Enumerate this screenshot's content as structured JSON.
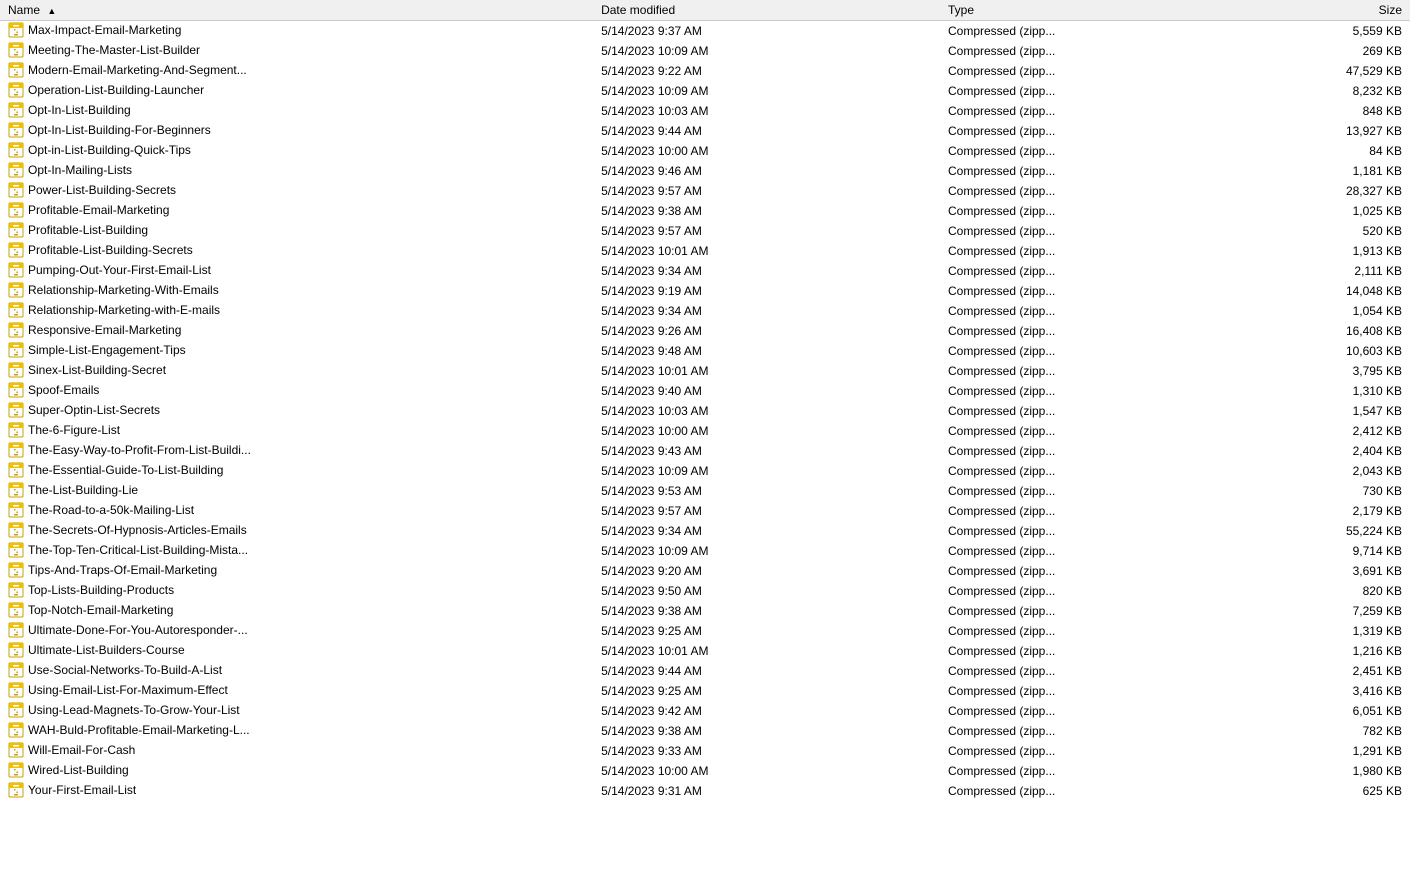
{
  "columns": [
    {
      "id": "name",
      "label": "Name",
      "sortable": true,
      "sort_arrow": "▲"
    },
    {
      "id": "date_modified",
      "label": "Date modified",
      "sortable": true
    },
    {
      "id": "type",
      "label": "Type",
      "sortable": true
    },
    {
      "id": "size",
      "label": "Size",
      "sortable": true
    }
  ],
  "files": [
    {
      "name": "Max-Impact-Email-Marketing",
      "date": "5/14/2023 9:37 AM",
      "type": "Compressed (zipp...",
      "size": "5,559 KB"
    },
    {
      "name": "Meeting-The-Master-List-Builder",
      "date": "5/14/2023 10:09 AM",
      "type": "Compressed (zipp...",
      "size": "269 KB"
    },
    {
      "name": "Modern-Email-Marketing-And-Segment...",
      "date": "5/14/2023 9:22 AM",
      "type": "Compressed (zipp...",
      "size": "47,529 KB"
    },
    {
      "name": "Operation-List-Building-Launcher",
      "date": "5/14/2023 10:09 AM",
      "type": "Compressed (zipp...",
      "size": "8,232 KB"
    },
    {
      "name": "Opt-In-List-Building",
      "date": "5/14/2023 10:03 AM",
      "type": "Compressed (zipp...",
      "size": "848 KB"
    },
    {
      "name": "Opt-In-List-Building-For-Beginners",
      "date": "5/14/2023 9:44 AM",
      "type": "Compressed (zipp...",
      "size": "13,927 KB"
    },
    {
      "name": "Opt-in-List-Building-Quick-Tips",
      "date": "5/14/2023 10:00 AM",
      "type": "Compressed (zipp...",
      "size": "84 KB"
    },
    {
      "name": "Opt-In-Mailing-Lists",
      "date": "5/14/2023 9:46 AM",
      "type": "Compressed (zipp...",
      "size": "1,181 KB"
    },
    {
      "name": "Power-List-Building-Secrets",
      "date": "5/14/2023 9:57 AM",
      "type": "Compressed (zipp...",
      "size": "28,327 KB"
    },
    {
      "name": "Profitable-Email-Marketing",
      "date": "5/14/2023 9:38 AM",
      "type": "Compressed (zipp...",
      "size": "1,025 KB"
    },
    {
      "name": "Profitable-List-Building",
      "date": "5/14/2023 9:57 AM",
      "type": "Compressed (zipp...",
      "size": "520 KB"
    },
    {
      "name": "Profitable-List-Building-Secrets",
      "date": "5/14/2023 10:01 AM",
      "type": "Compressed (zipp...",
      "size": "1,913 KB"
    },
    {
      "name": "Pumping-Out-Your-First-Email-List",
      "date": "5/14/2023 9:34 AM",
      "type": "Compressed (zipp...",
      "size": "2,111 KB"
    },
    {
      "name": "Relationship-Marketing-With-Emails",
      "date": "5/14/2023 9:19 AM",
      "type": "Compressed (zipp...",
      "size": "14,048 KB"
    },
    {
      "name": "Relationship-Marketing-with-E-mails",
      "date": "5/14/2023 9:34 AM",
      "type": "Compressed (zipp...",
      "size": "1,054 KB"
    },
    {
      "name": "Responsive-Email-Marketing",
      "date": "5/14/2023 9:26 AM",
      "type": "Compressed (zipp...",
      "size": "16,408 KB"
    },
    {
      "name": "Simple-List-Engagement-Tips",
      "date": "5/14/2023 9:48 AM",
      "type": "Compressed (zipp...",
      "size": "10,603 KB"
    },
    {
      "name": "Sinex-List-Building-Secret",
      "date": "5/14/2023 10:01 AM",
      "type": "Compressed (zipp...",
      "size": "3,795 KB"
    },
    {
      "name": "Spoof-Emails",
      "date": "5/14/2023 9:40 AM",
      "type": "Compressed (zipp...",
      "size": "1,310 KB"
    },
    {
      "name": "Super-Optin-List-Secrets",
      "date": "5/14/2023 10:03 AM",
      "type": "Compressed (zipp...",
      "size": "1,547 KB"
    },
    {
      "name": "The-6-Figure-List",
      "date": "5/14/2023 10:00 AM",
      "type": "Compressed (zipp...",
      "size": "2,412 KB"
    },
    {
      "name": "The-Easy-Way-to-Profit-From-List-Buildi...",
      "date": "5/14/2023 9:43 AM",
      "type": "Compressed (zipp...",
      "size": "2,404 KB"
    },
    {
      "name": "The-Essential-Guide-To-List-Building",
      "date": "5/14/2023 10:09 AM",
      "type": "Compressed (zipp...",
      "size": "2,043 KB"
    },
    {
      "name": "The-List-Building-Lie",
      "date": "5/14/2023 9:53 AM",
      "type": "Compressed (zipp...",
      "size": "730 KB"
    },
    {
      "name": "The-Road-to-a-50k-Mailing-List",
      "date": "5/14/2023 9:57 AM",
      "type": "Compressed (zipp...",
      "size": "2,179 KB"
    },
    {
      "name": "The-Secrets-Of-Hypnosis-Articles-Emails",
      "date": "5/14/2023 9:34 AM",
      "type": "Compressed (zipp...",
      "size": "55,224 KB"
    },
    {
      "name": "The-Top-Ten-Critical-List-Building-Mista...",
      "date": "5/14/2023 10:09 AM",
      "type": "Compressed (zipp...",
      "size": "9,714 KB"
    },
    {
      "name": "Tips-And-Traps-Of-Email-Marketing",
      "date": "5/14/2023 9:20 AM",
      "type": "Compressed (zipp...",
      "size": "3,691 KB"
    },
    {
      "name": "Top-Lists-Building-Products",
      "date": "5/14/2023 9:50 AM",
      "type": "Compressed (zipp...",
      "size": "820 KB"
    },
    {
      "name": "Top-Notch-Email-Marketing",
      "date": "5/14/2023 9:38 AM",
      "type": "Compressed (zipp...",
      "size": "7,259 KB"
    },
    {
      "name": "Ultimate-Done-For-You-Autoresponder-...",
      "date": "5/14/2023 9:25 AM",
      "type": "Compressed (zipp...",
      "size": "1,319 KB"
    },
    {
      "name": "Ultimate-List-Builders-Course",
      "date": "5/14/2023 10:01 AM",
      "type": "Compressed (zipp...",
      "size": "1,216 KB"
    },
    {
      "name": "Use-Social-Networks-To-Build-A-List",
      "date": "5/14/2023 9:44 AM",
      "type": "Compressed (zipp...",
      "size": "2,451 KB"
    },
    {
      "name": "Using-Email-List-For-Maximum-Effect",
      "date": "5/14/2023 9:25 AM",
      "type": "Compressed (zipp...",
      "size": "3,416 KB"
    },
    {
      "name": "Using-Lead-Magnets-To-Grow-Your-List",
      "date": "5/14/2023 9:42 AM",
      "type": "Compressed (zipp...",
      "size": "6,051 KB"
    },
    {
      "name": "WAH-Buld-Profitable-Email-Marketing-L...",
      "date": "5/14/2023 9:38 AM",
      "type": "Compressed (zipp...",
      "size": "782 KB"
    },
    {
      "name": "Will-Email-For-Cash",
      "date": "5/14/2023 9:33 AM",
      "type": "Compressed (zipp...",
      "size": "1,291 KB"
    },
    {
      "name": "Wired-List-Building",
      "date": "5/14/2023 10:00 AM",
      "type": "Compressed (zipp...",
      "size": "1,980 KB"
    },
    {
      "name": "Your-First-Email-List",
      "date": "5/14/2023 9:31 AM",
      "type": "Compressed (zipp...",
      "size": "625 KB"
    }
  ]
}
